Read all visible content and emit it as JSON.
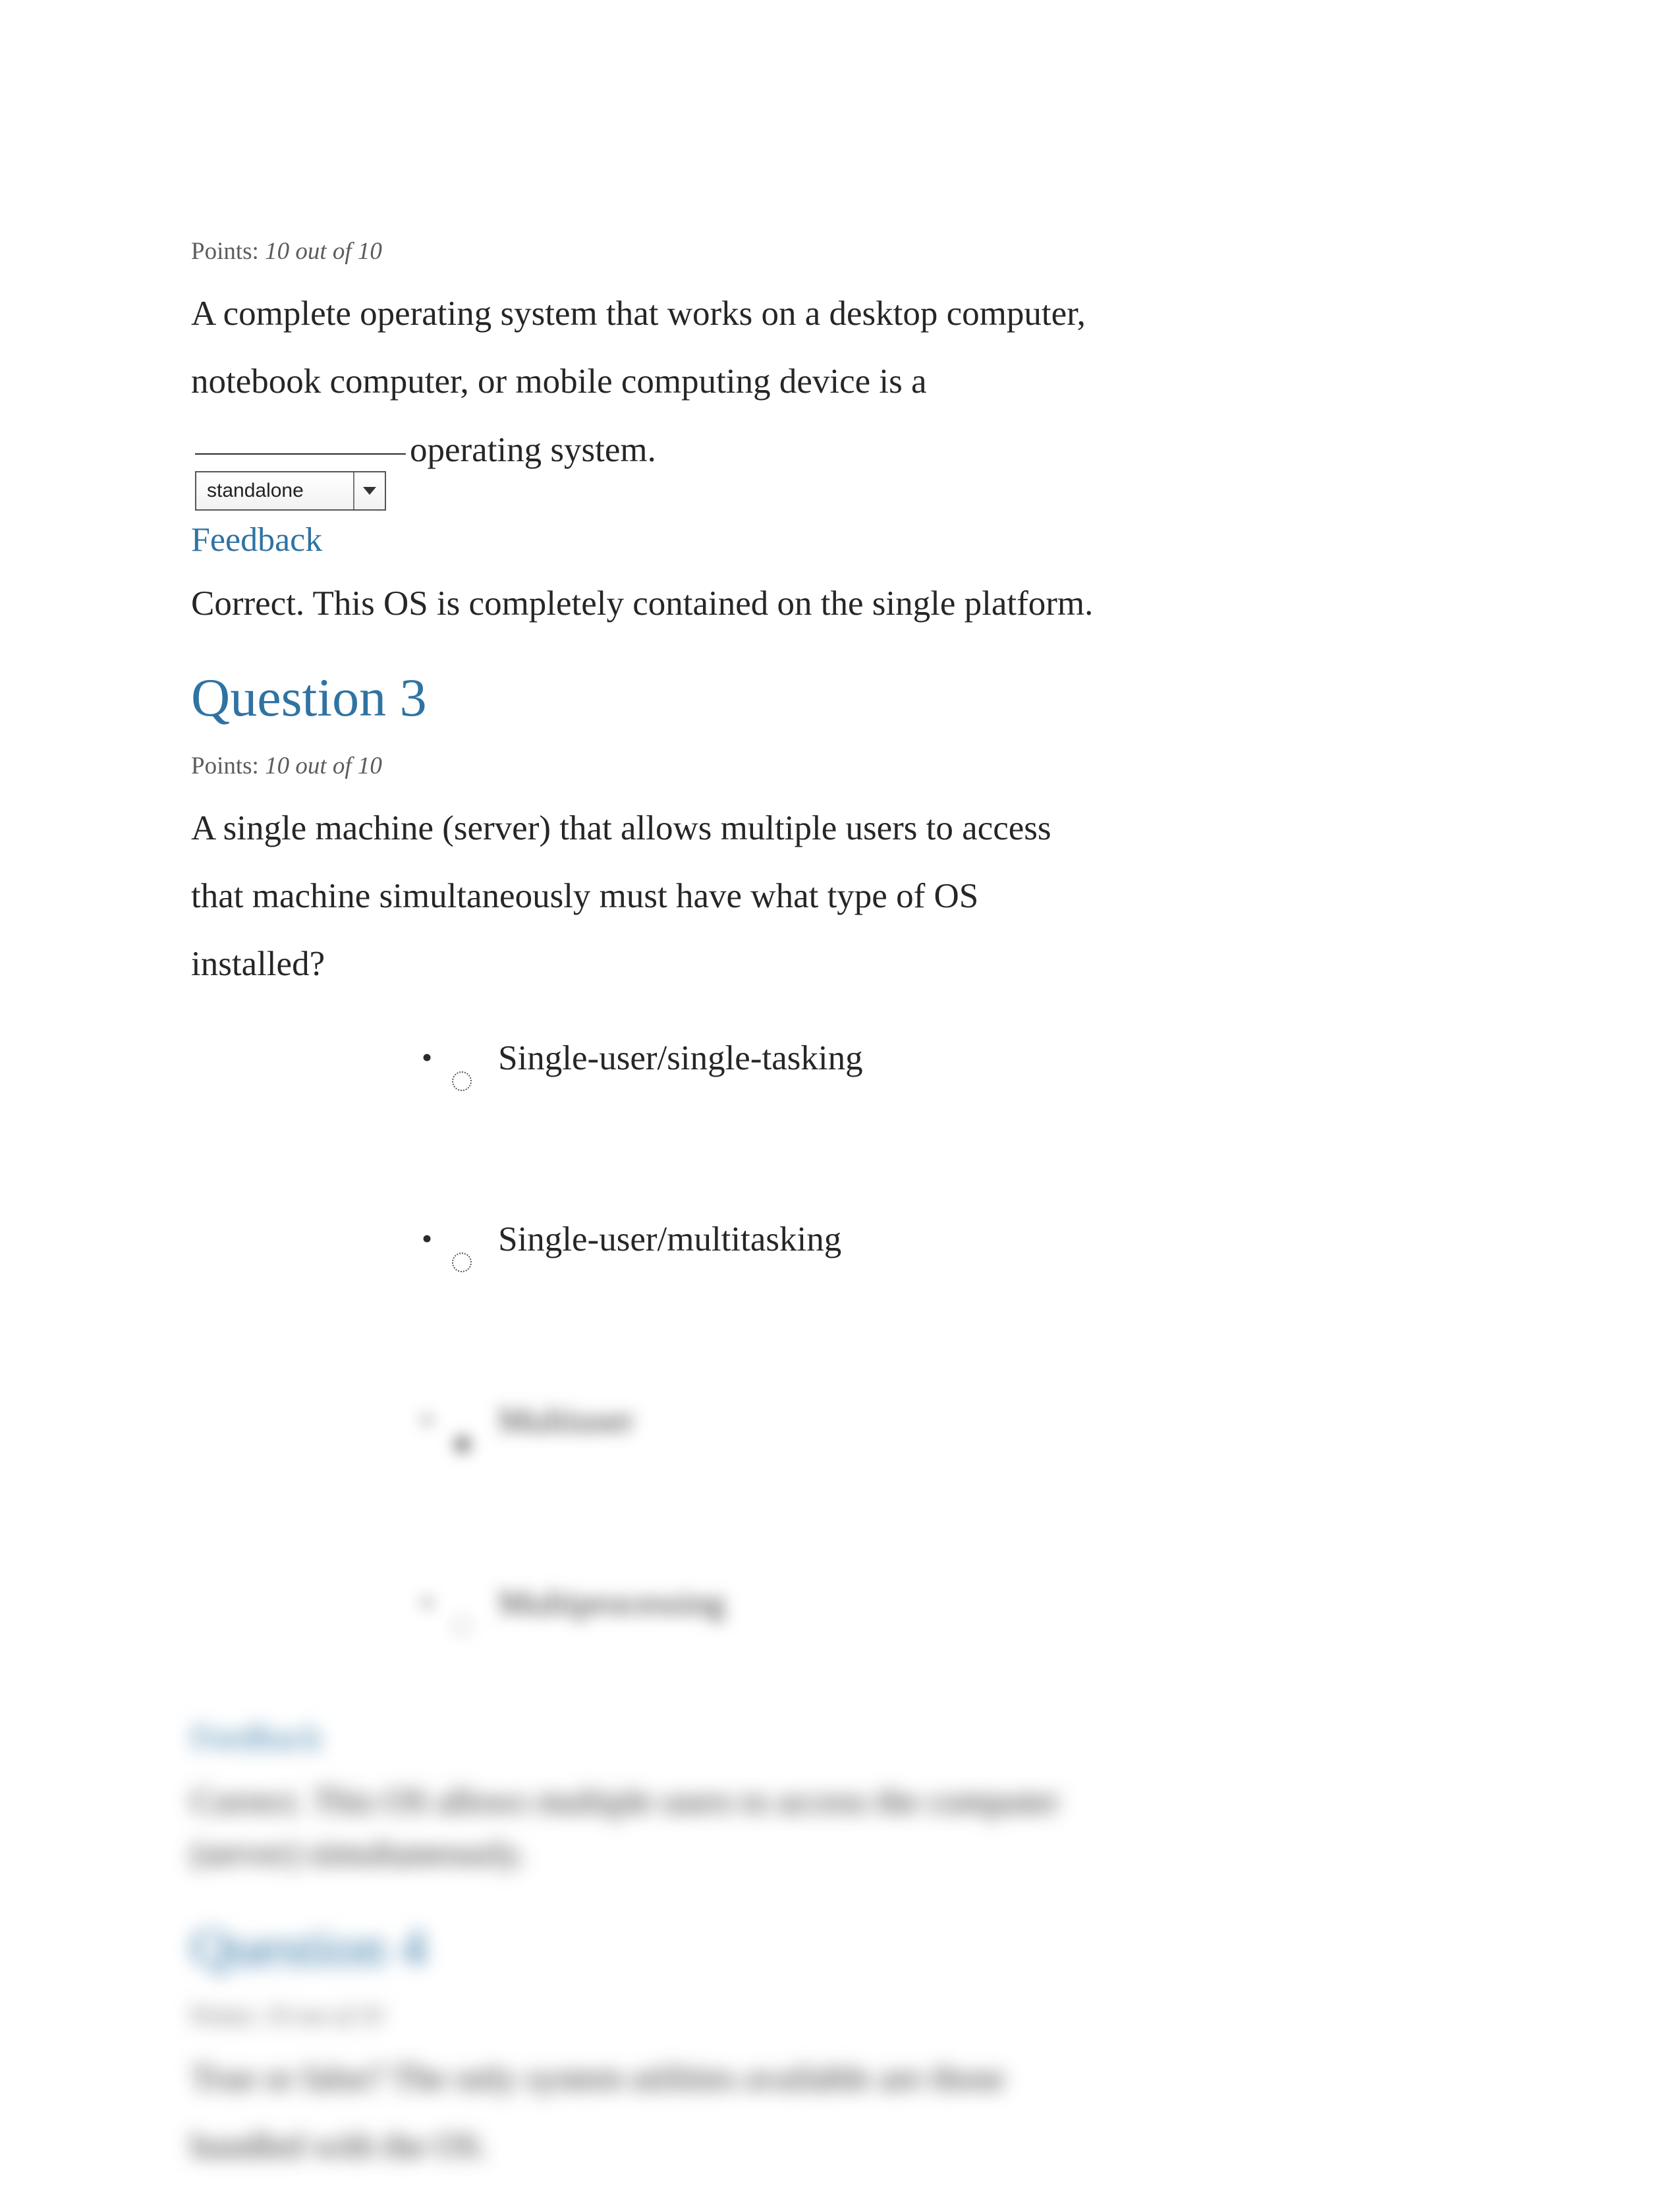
{
  "q2": {
    "points_label": "Points: ",
    "points_value": "10 out of 10",
    "stem_pre": "A complete operating system that works on a desktop computer, notebook computer, or mobile computing device is a ",
    "stem_post": "operating system.",
    "dropdown_value": "standalone",
    "feedback_heading": "Feedback",
    "feedback_text": "Correct. This OS is completely contained on the single platform."
  },
  "q3": {
    "heading": "Question 3",
    "points_label": "Points: ",
    "points_value": "10 out of 10",
    "stem": "A single machine (server) that allows multiple users to access that machine simultaneously must have what type of OS installed?",
    "options": [
      "Single-user/single-tasking",
      "Single-user/multitasking",
      "Multiuser",
      "Multiprocessing"
    ],
    "feedback_heading": "Feedback",
    "feedback_text": "Correct. This OS allows multiple users to access the computer (server) simultaneously."
  },
  "q4": {
    "heading": "Question 4",
    "points_label": "Points: ",
    "points_value": "10 out of 10",
    "stem": "True or false? The only system utilities available are those bundled with the OS."
  }
}
